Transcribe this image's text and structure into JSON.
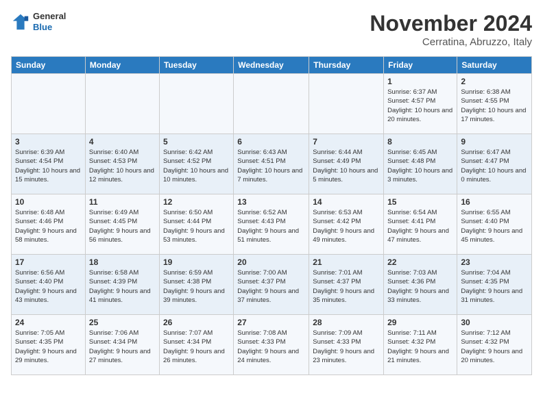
{
  "header": {
    "logo_general": "General",
    "logo_blue": "Blue",
    "month_title": "November 2024",
    "location": "Cerratina, Abruzzo, Italy"
  },
  "weekdays": [
    "Sunday",
    "Monday",
    "Tuesday",
    "Wednesday",
    "Thursday",
    "Friday",
    "Saturday"
  ],
  "weeks": [
    [
      {
        "day": "",
        "info": ""
      },
      {
        "day": "",
        "info": ""
      },
      {
        "day": "",
        "info": ""
      },
      {
        "day": "",
        "info": ""
      },
      {
        "day": "",
        "info": ""
      },
      {
        "day": "1",
        "info": "Sunrise: 6:37 AM\nSunset: 4:57 PM\nDaylight: 10 hours and 20 minutes."
      },
      {
        "day": "2",
        "info": "Sunrise: 6:38 AM\nSunset: 4:55 PM\nDaylight: 10 hours and 17 minutes."
      }
    ],
    [
      {
        "day": "3",
        "info": "Sunrise: 6:39 AM\nSunset: 4:54 PM\nDaylight: 10 hours and 15 minutes."
      },
      {
        "day": "4",
        "info": "Sunrise: 6:40 AM\nSunset: 4:53 PM\nDaylight: 10 hours and 12 minutes."
      },
      {
        "day": "5",
        "info": "Sunrise: 6:42 AM\nSunset: 4:52 PM\nDaylight: 10 hours and 10 minutes."
      },
      {
        "day": "6",
        "info": "Sunrise: 6:43 AM\nSunset: 4:51 PM\nDaylight: 10 hours and 7 minutes."
      },
      {
        "day": "7",
        "info": "Sunrise: 6:44 AM\nSunset: 4:49 PM\nDaylight: 10 hours and 5 minutes."
      },
      {
        "day": "8",
        "info": "Sunrise: 6:45 AM\nSunset: 4:48 PM\nDaylight: 10 hours and 3 minutes."
      },
      {
        "day": "9",
        "info": "Sunrise: 6:47 AM\nSunset: 4:47 PM\nDaylight: 10 hours and 0 minutes."
      }
    ],
    [
      {
        "day": "10",
        "info": "Sunrise: 6:48 AM\nSunset: 4:46 PM\nDaylight: 9 hours and 58 minutes."
      },
      {
        "day": "11",
        "info": "Sunrise: 6:49 AM\nSunset: 4:45 PM\nDaylight: 9 hours and 56 minutes."
      },
      {
        "day": "12",
        "info": "Sunrise: 6:50 AM\nSunset: 4:44 PM\nDaylight: 9 hours and 53 minutes."
      },
      {
        "day": "13",
        "info": "Sunrise: 6:52 AM\nSunset: 4:43 PM\nDaylight: 9 hours and 51 minutes."
      },
      {
        "day": "14",
        "info": "Sunrise: 6:53 AM\nSunset: 4:42 PM\nDaylight: 9 hours and 49 minutes."
      },
      {
        "day": "15",
        "info": "Sunrise: 6:54 AM\nSunset: 4:41 PM\nDaylight: 9 hours and 47 minutes."
      },
      {
        "day": "16",
        "info": "Sunrise: 6:55 AM\nSunset: 4:40 PM\nDaylight: 9 hours and 45 minutes."
      }
    ],
    [
      {
        "day": "17",
        "info": "Sunrise: 6:56 AM\nSunset: 4:40 PM\nDaylight: 9 hours and 43 minutes."
      },
      {
        "day": "18",
        "info": "Sunrise: 6:58 AM\nSunset: 4:39 PM\nDaylight: 9 hours and 41 minutes."
      },
      {
        "day": "19",
        "info": "Sunrise: 6:59 AM\nSunset: 4:38 PM\nDaylight: 9 hours and 39 minutes."
      },
      {
        "day": "20",
        "info": "Sunrise: 7:00 AM\nSunset: 4:37 PM\nDaylight: 9 hours and 37 minutes."
      },
      {
        "day": "21",
        "info": "Sunrise: 7:01 AM\nSunset: 4:37 PM\nDaylight: 9 hours and 35 minutes."
      },
      {
        "day": "22",
        "info": "Sunrise: 7:03 AM\nSunset: 4:36 PM\nDaylight: 9 hours and 33 minutes."
      },
      {
        "day": "23",
        "info": "Sunrise: 7:04 AM\nSunset: 4:35 PM\nDaylight: 9 hours and 31 minutes."
      }
    ],
    [
      {
        "day": "24",
        "info": "Sunrise: 7:05 AM\nSunset: 4:35 PM\nDaylight: 9 hours and 29 minutes."
      },
      {
        "day": "25",
        "info": "Sunrise: 7:06 AM\nSunset: 4:34 PM\nDaylight: 9 hours and 27 minutes."
      },
      {
        "day": "26",
        "info": "Sunrise: 7:07 AM\nSunset: 4:34 PM\nDaylight: 9 hours and 26 minutes."
      },
      {
        "day": "27",
        "info": "Sunrise: 7:08 AM\nSunset: 4:33 PM\nDaylight: 9 hours and 24 minutes."
      },
      {
        "day": "28",
        "info": "Sunrise: 7:09 AM\nSunset: 4:33 PM\nDaylight: 9 hours and 23 minutes."
      },
      {
        "day": "29",
        "info": "Sunrise: 7:11 AM\nSunset: 4:32 PM\nDaylight: 9 hours and 21 minutes."
      },
      {
        "day": "30",
        "info": "Sunrise: 7:12 AM\nSunset: 4:32 PM\nDaylight: 9 hours and 20 minutes."
      }
    ]
  ]
}
